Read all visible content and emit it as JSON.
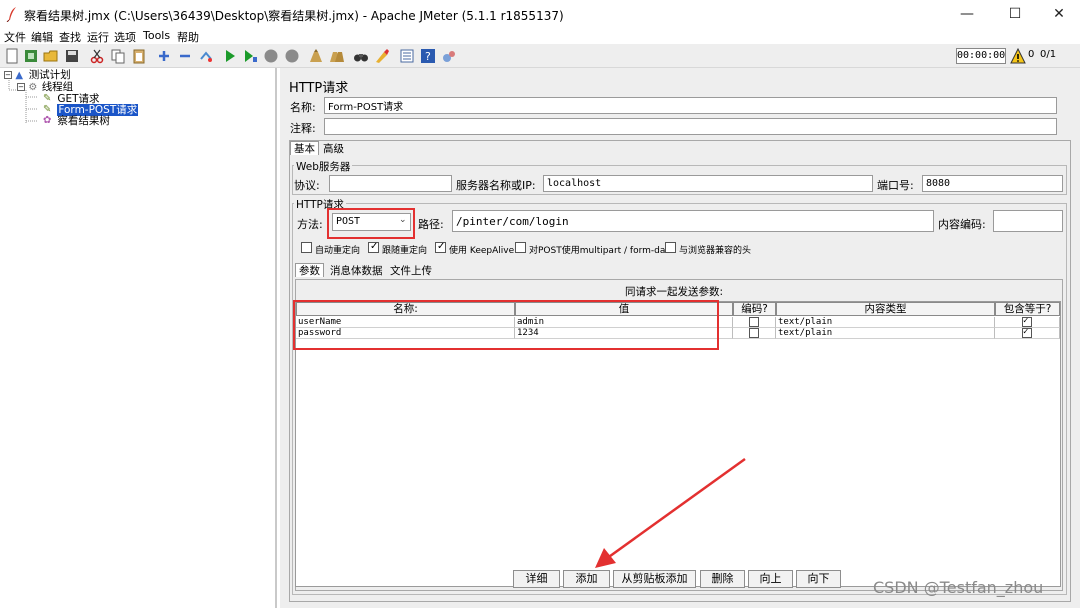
{
  "window": {
    "title": "察看结果树.jmx (C:\\Users\\36439\\Desktop\\察看结果树.jmx) - Apache JMeter (5.1.1 r1855137)",
    "minimize": "—",
    "maximize": "☐",
    "close": "✕"
  },
  "menu": [
    "文件",
    "编辑",
    "查找",
    "运行",
    "选项",
    "Tools",
    "帮助"
  ],
  "toolbar": {
    "timer": "00:00:00",
    "warnings": "0",
    "threads": "0/1"
  },
  "tree": {
    "items": [
      {
        "label": "测试计划",
        "icon": "test-plan-icon"
      },
      {
        "label": "线程组",
        "icon": "thread-group-icon"
      },
      {
        "label": "GET请求",
        "icon": "sampler-icon"
      },
      {
        "label": "Form-POST请求",
        "icon": "sampler-icon"
      },
      {
        "label": "察看结果树",
        "icon": "listener-icon"
      }
    ]
  },
  "panel": {
    "title": "HTTP请求",
    "name_label": "名称:",
    "name_value": "Form-POST请求",
    "comment_label": "注释:",
    "comment_value": "",
    "tabs": [
      "基本",
      "高级"
    ],
    "web_server": {
      "title": "Web服务器",
      "protocol_label": "协议:",
      "protocol_value": "",
      "server_label": "服务器名称或IP:",
      "server_value": "localhost",
      "port_label": "端口号:",
      "port_value": "8080"
    },
    "http_request": {
      "title": "HTTP请求",
      "method_label": "方法:",
      "method_value": "POST",
      "path_label": "路径:",
      "path_value": "/pinter/com/login",
      "encoding_label": "内容编码:",
      "encoding_value": ""
    },
    "options": [
      {
        "label": "自动重定向",
        "checked": false
      },
      {
        "label": "跟随重定向",
        "checked": true
      },
      {
        "label": "使用 KeepAlive",
        "checked": true
      },
      {
        "label": "对POST使用multipart / form-data",
        "checked": false
      },
      {
        "label": "与浏览器兼容的头",
        "checked": false
      }
    ],
    "subtabs": [
      "参数",
      "消息体数据",
      "文件上传"
    ],
    "params_caption": "同请求一起发送参数:",
    "columns": [
      "名称:",
      "值",
      "编码?",
      "内容类型",
      "包含等于?"
    ],
    "rows": [
      {
        "name": "userName",
        "value": "admin",
        "encode": false,
        "content_type": "text/plain",
        "include_equals": true
      },
      {
        "name": "password",
        "value": "1234",
        "encode": false,
        "content_type": "text/plain",
        "include_equals": true
      }
    ],
    "buttons": [
      "详细",
      "添加",
      "从剪贴板添加",
      "删除",
      "向上",
      "向下"
    ]
  },
  "watermark": "CSDN @Testfan_zhou",
  "colors": {
    "highlight": "#1a55c8",
    "annotation_red": "#e33030",
    "panel_bg": "#eeeeee"
  }
}
